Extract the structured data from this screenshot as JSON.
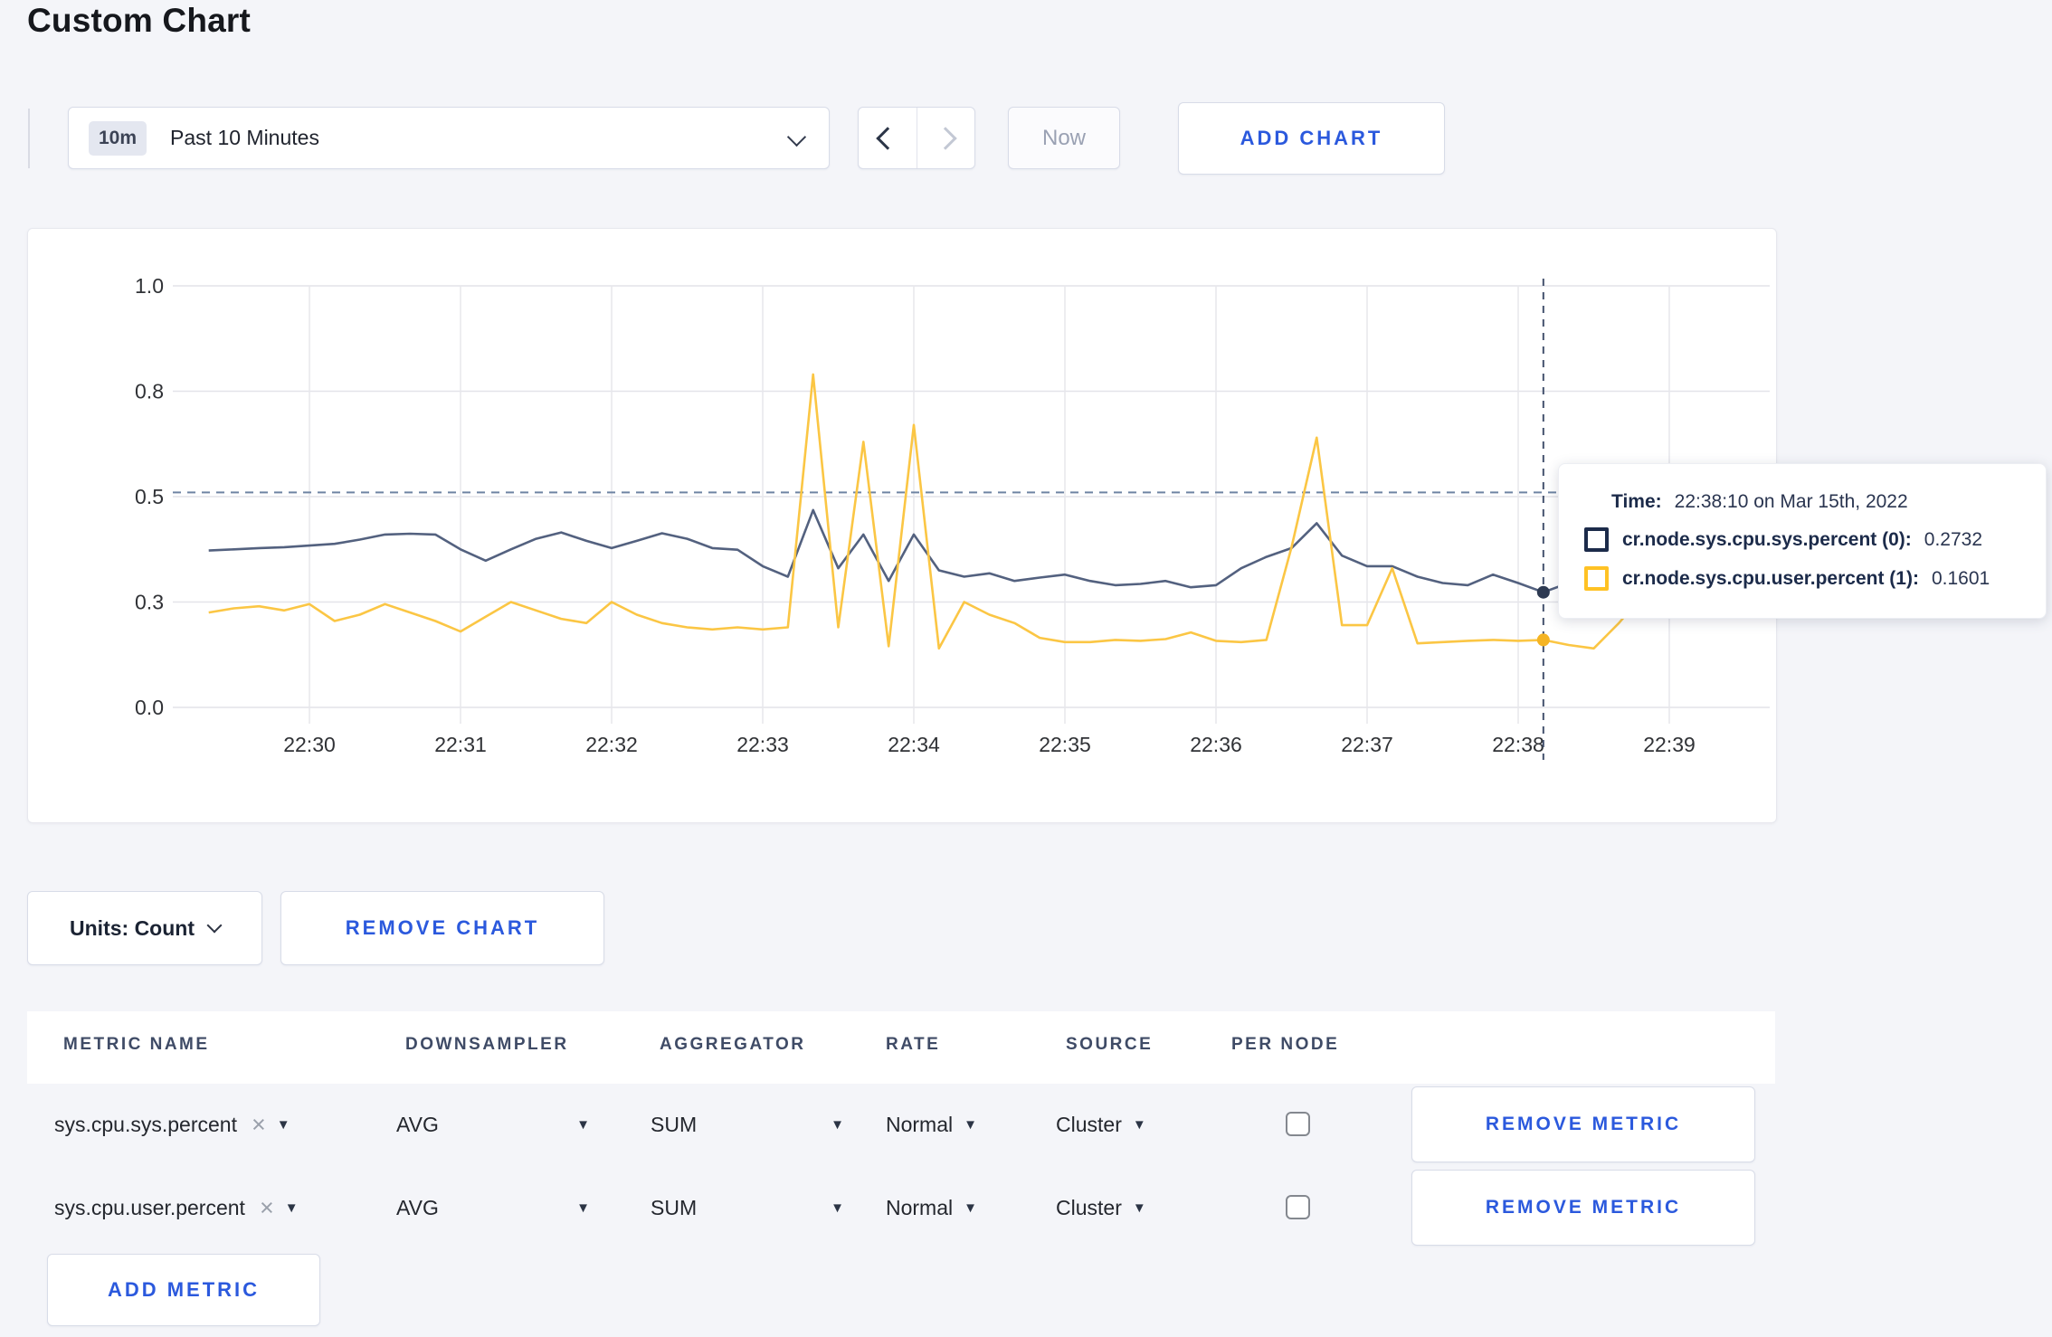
{
  "page": {
    "title": "Custom Chart"
  },
  "toolbar": {
    "time_range": {
      "badge": "10m",
      "label": "Past 10 Minutes"
    },
    "now_label": "Now",
    "add_chart_label": "ADD CHART"
  },
  "chart_controls": {
    "units_label": "Units: Count",
    "remove_chart_label": "REMOVE CHART"
  },
  "chart_data": {
    "type": "line",
    "title": "",
    "xlabel": "",
    "ylabel": "",
    "ylim": [
      0,
      1
    ],
    "grid": true,
    "legend_position": "tooltip",
    "x_start": "22:29:20",
    "x_interval_seconds": 10,
    "x_ticks": [
      "22:30",
      "22:31",
      "22:32",
      "22:33",
      "22:34",
      "22:35",
      "22:36",
      "22:37",
      "22:38",
      "22:39"
    ],
    "y_ticks": [
      {
        "value": 0.0,
        "label": "0.0"
      },
      {
        "value": 0.25,
        "label": "0.3"
      },
      {
        "value": 0.5,
        "label": "0.5"
      },
      {
        "value": 0.75,
        "label": "0.8"
      },
      {
        "value": 1.0,
        "label": "1.0"
      }
    ],
    "series": [
      {
        "name": "cr.node.sys.cpu.sys.percent",
        "color": "#53617f",
        "dot_color": "#2e3a52",
        "values": [
          0.372,
          0.375,
          0.378,
          0.38,
          0.384,
          0.388,
          0.398,
          0.41,
          0.412,
          0.41,
          0.375,
          0.348,
          0.375,
          0.4,
          0.415,
          0.395,
          0.378,
          0.395,
          0.413,
          0.4,
          0.378,
          0.374,
          0.335,
          0.31,
          0.468,
          0.33,
          0.41,
          0.3,
          0.41,
          0.325,
          0.31,
          0.318,
          0.3,
          0.308,
          0.315,
          0.3,
          0.29,
          0.293,
          0.3,
          0.285,
          0.29,
          0.33,
          0.357,
          0.378,
          0.437,
          0.36,
          0.335,
          0.335,
          0.31,
          0.295,
          0.29,
          0.315,
          0.295,
          0.2732,
          0.295,
          0.3,
          0.295,
          0.3,
          0.305,
          0.3
        ]
      },
      {
        "name": "cr.node.sys.cpu.user.percent",
        "color": "#fbc644",
        "dot_color": "#f5b423",
        "values": [
          0.225,
          0.235,
          0.24,
          0.23,
          0.245,
          0.205,
          0.22,
          0.245,
          0.225,
          0.205,
          0.18,
          0.215,
          0.25,
          0.23,
          0.21,
          0.2,
          0.25,
          0.22,
          0.2,
          0.19,
          0.185,
          0.19,
          0.185,
          0.19,
          0.79,
          0.19,
          0.63,
          0.145,
          0.67,
          0.14,
          0.25,
          0.22,
          0.2,
          0.165,
          0.155,
          0.155,
          0.16,
          0.158,
          0.162,
          0.178,
          0.158,
          0.155,
          0.16,
          0.38,
          0.64,
          0.195,
          0.195,
          0.33,
          0.152,
          0.155,
          0.158,
          0.16,
          0.158,
          0.1601,
          0.148,
          0.14,
          0.2,
          0.27,
          0.265,
          0.225
        ]
      }
    ],
    "crosshair": {
      "time": "22:38:10",
      "hline_value": 0.51
    }
  },
  "tooltip": {
    "time_label": "Time:",
    "time_value": "22:38:10 on Mar 15th, 2022",
    "series": [
      {
        "label": "cr.node.sys.cpu.sys.percent (0):",
        "value": "0.2732",
        "color": "#1c2b4a"
      },
      {
        "label": "cr.node.sys.cpu.user.percent (1):",
        "value": "0.1601",
        "color": "#ffc224"
      }
    ]
  },
  "icons": {
    "caret_down": "▼",
    "clear_x": "×"
  },
  "metrics_table": {
    "headers": [
      "METRIC NAME",
      "DOWNSAMPLER",
      "AGGREGATOR",
      "RATE",
      "SOURCE",
      "PER NODE"
    ],
    "rows": [
      {
        "metric": "sys.cpu.sys.percent",
        "downsampler": "AVG",
        "aggregator": "SUM",
        "rate": "Normal",
        "source": "Cluster",
        "per_node_checked": false,
        "remove_label": "REMOVE METRIC"
      },
      {
        "metric": "sys.cpu.user.percent",
        "downsampler": "AVG",
        "aggregator": "SUM",
        "rate": "Normal",
        "source": "Cluster",
        "per_node_checked": false,
        "remove_label": "REMOVE METRIC"
      }
    ],
    "add_metric_label": "ADD METRIC"
  }
}
